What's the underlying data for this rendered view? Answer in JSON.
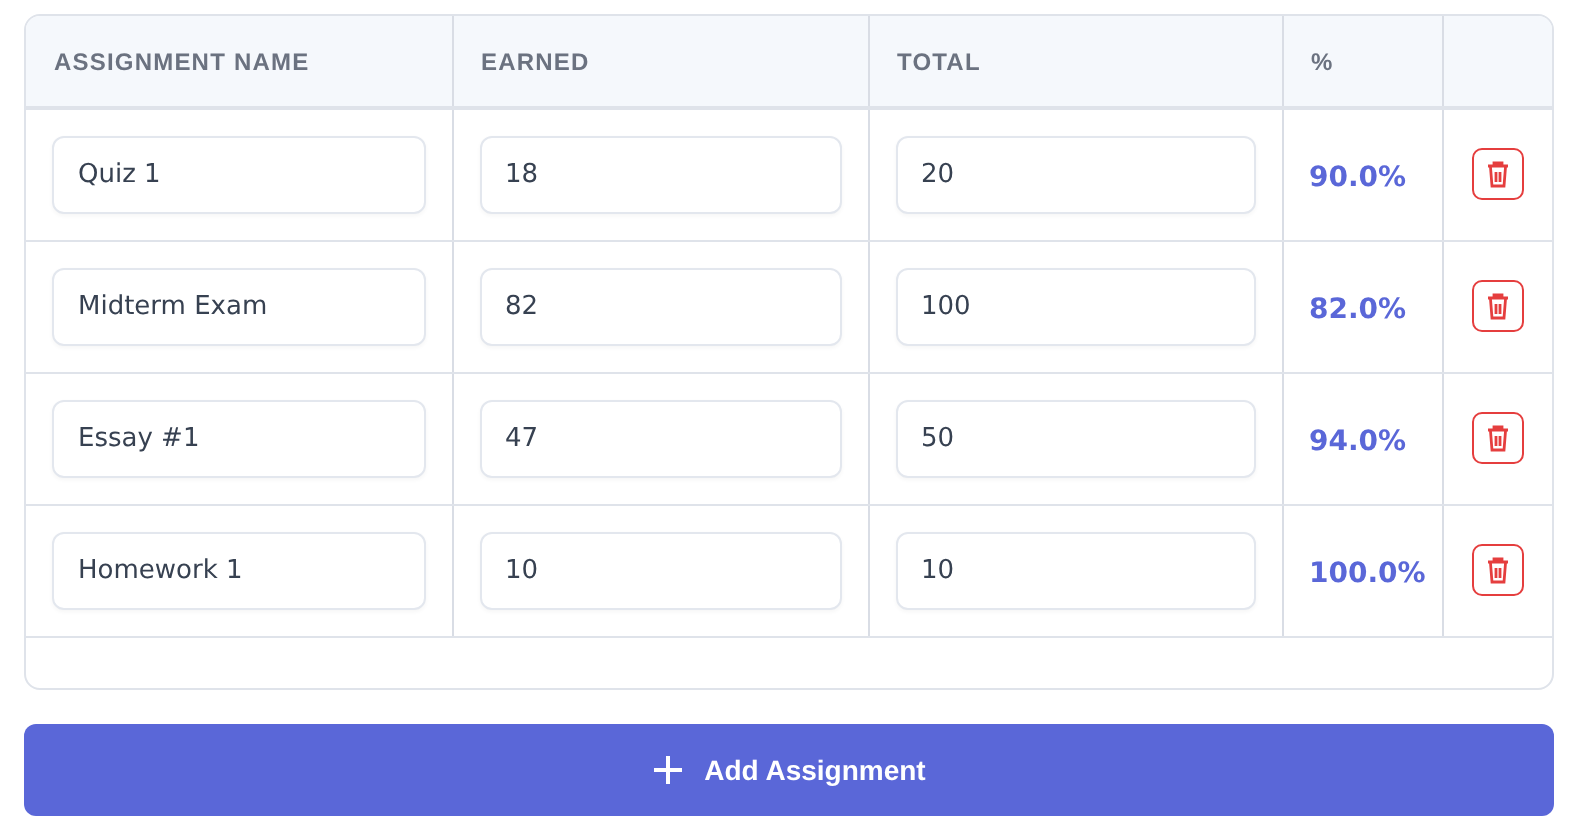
{
  "table": {
    "columns": [
      "ASSIGNMENT NAME",
      "EARNED",
      "TOTAL",
      "%"
    ],
    "rows": [
      {
        "name": "Quiz 1",
        "earned": "18",
        "total": "20",
        "percent": "90.0%"
      },
      {
        "name": "Midterm Exam",
        "earned": "82",
        "total": "100",
        "percent": "82.0%"
      },
      {
        "name": "Essay #1",
        "earned": "47",
        "total": "50",
        "percent": "94.0%"
      },
      {
        "name": "Homework 1",
        "earned": "10",
        "total": "10",
        "percent": "100.0%"
      }
    ]
  },
  "add_button": {
    "label": "Add Assignment"
  }
}
